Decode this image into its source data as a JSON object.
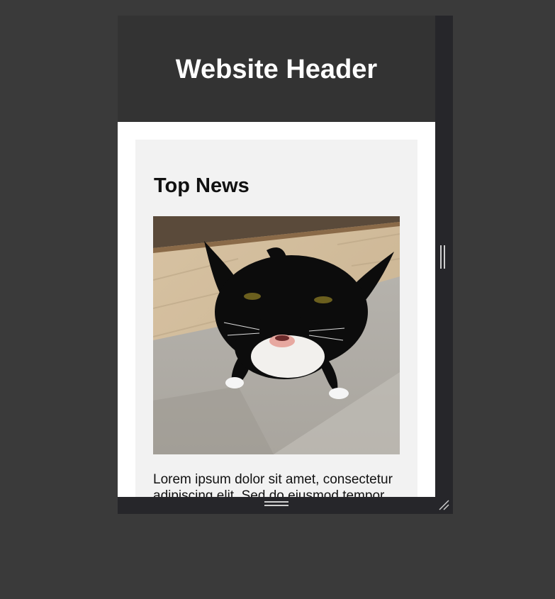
{
  "header": {
    "title": "Website Header"
  },
  "article": {
    "heading": "Top News",
    "image_alt": "black and white cat",
    "body": "Lorem ipsum dolor sit amet, consectetur adipiscing elit. Sed do eiusmod tempor incididunt ut labore et dolore magna aliqua."
  },
  "icons": {
    "vertical_resize": "vertical-resize-handle-icon",
    "horizontal_resize": "horizontal-resize-handle-icon",
    "corner_resize": "corner-resize-grip-icon"
  },
  "colors": {
    "page_background": "#3a3a3a",
    "frame_chrome": "#26262a",
    "header_background": "#333333",
    "card_background": "#f2f2f2"
  }
}
